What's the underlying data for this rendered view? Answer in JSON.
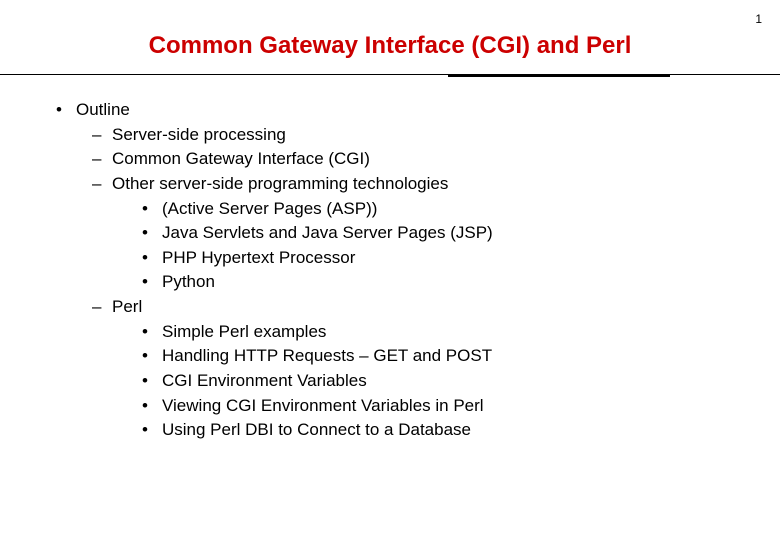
{
  "page_number": "1",
  "title": "Common Gateway  Interface (CGI) and Perl",
  "outline": {
    "heading": "Outline",
    "level2": [
      {
        "label": "Server-side processing"
      },
      {
        "label": "Common Gateway Interface (CGI)"
      },
      {
        "label": "Other server-side programming technologies",
        "children": [
          "(Active Server Pages (ASP))",
          "Java Servlets and Java Server Pages (JSP)",
          "PHP Hypertext Processor",
          "Python"
        ]
      },
      {
        "label": "Perl",
        "children": [
          "Simple Perl examples",
          "Handling HTTP Requests – GET and POST",
          "CGI Environment Variables",
          "Viewing CGI Environment Variables in Perl",
          "Using Perl DBI to Connect to a Database"
        ]
      }
    ]
  },
  "bullets": {
    "l1": "•",
    "l2": "–",
    "l3": "•"
  }
}
